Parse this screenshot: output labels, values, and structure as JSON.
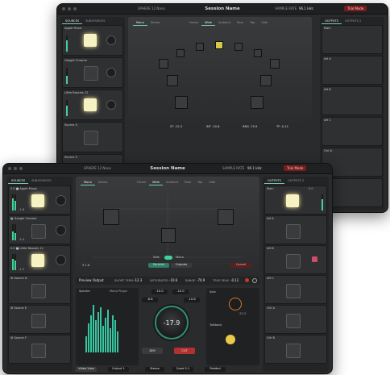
{
  "back": {
    "title": "Session Name",
    "app_label": "SPHERE 12 Nano",
    "sample_rate_label": "SAMPLE RATE",
    "sample_rate": "96.1 kHz",
    "trial_button": "Trial Mode",
    "tabs_left": [
      "SOURCES",
      "SUBSOURCES"
    ],
    "tabs_right": [
      "OUTPUTS",
      "OUTPUTS 2"
    ],
    "view_tabs": [
      "Mono",
      "Stereo"
    ],
    "format_tabs": [
      "Forest",
      "Wide",
      "Ambient",
      "Rear",
      "Top",
      "Side"
    ],
    "source_channels": [
      {
        "num": "2.0",
        "name": "Apple Music"
      },
      {
        "num": "",
        "name": "Google Chrome"
      },
      {
        "num": "2.0",
        "name": "Little Rascals 12"
      },
      {
        "num": "2.0",
        "name": "Source 4"
      },
      {
        "num": "",
        "name": "Source 5"
      }
    ],
    "output_channels": [
      "Main",
      "AH A",
      "AH B",
      "AH C",
      "Ctrl A",
      "Ctrl B"
    ],
    "readout": {
      "short_term": "-12.3",
      "integrated": "-10.6",
      "range": "-70.9",
      "true_peak": "-0.12"
    }
  },
  "front": {
    "title": "Session Name",
    "app_label": "SPHERE 12 Nano",
    "sample_rate_label": "SAMPLE RATE",
    "sample_rate": "96.1 kHz",
    "trial_button": "Trial Mode",
    "tabs_left": [
      "SOURCES",
      "SUBSOURCES"
    ],
    "tabs_right": [
      "OUTPUTS",
      "OUTPUTS 2"
    ],
    "view_tabs": [
      "Mono",
      "Stereo"
    ],
    "format_tabs": [
      "Forest",
      "Wide",
      "Ambient",
      "Rear",
      "Top",
      "Side"
    ],
    "toggle_labels": [
      "Side",
      "Mono"
    ],
    "room_buttons": [
      "Sources",
      "Outputs"
    ],
    "cancel_label": "Cancel",
    "source_channels": [
      {
        "num": "2.0",
        "name": "Apple Music",
        "level": "-1.8"
      },
      {
        "num": "",
        "name": "Google Chrome",
        "level": "-3.0"
      },
      {
        "num": "2.0",
        "name": "Little Rascals 12",
        "level": "-1.2"
      },
      {
        "num": "",
        "name": "Source D",
        "level": ""
      },
      {
        "num": "",
        "name": "Source E",
        "level": ""
      },
      {
        "num": "",
        "name": "Source F",
        "level": ""
      }
    ],
    "output_channels": [
      "Main",
      "AH A",
      "AH B",
      "AH C",
      "Ctrl A",
      "Ctrl B"
    ],
    "output_level": "0.0",
    "format_value": "5.1.6",
    "output_select": "Preview Output",
    "readout": {
      "short_term_label": "SHORT TERM",
      "short_term": "-12.3",
      "integrated_label": "INTEGRATED",
      "integrated": "-10.6",
      "range_label": "RANGE",
      "range": "-70.9",
      "true_peak_label": "TRUE PEAK",
      "true_peak": "-0.12"
    },
    "spectrum_label": "Spectre",
    "spectrum_mode": "Mono Plugin",
    "spectrum_bars": [
      0.3,
      0.55,
      0.7,
      0.9,
      0.6,
      0.75,
      0.85,
      0.5,
      0.65,
      0.8,
      0.45,
      0.7,
      0.6,
      0.4
    ],
    "master": {
      "value": "-17.9",
      "left": "-10.0",
      "right": "-10.0",
      "left2": "-6.8",
      "right2": "-10.8"
    },
    "dim_button": "DIM",
    "cut_button": "CUT",
    "side_labels": [
      "Solo",
      "Talkback"
    ],
    "side_level": "-22.3",
    "bottom_bar": {
      "view": "Video View",
      "output": "Output 1",
      "stereo": "Stereo",
      "quad": "Quad 5.1",
      "format": "Padded"
    }
  },
  "colors": {
    "accent": "#3fd39a",
    "pad_yellow": "#f7f2c1",
    "danger": "#c0392b",
    "brand_blue": "#4a7fd6"
  }
}
